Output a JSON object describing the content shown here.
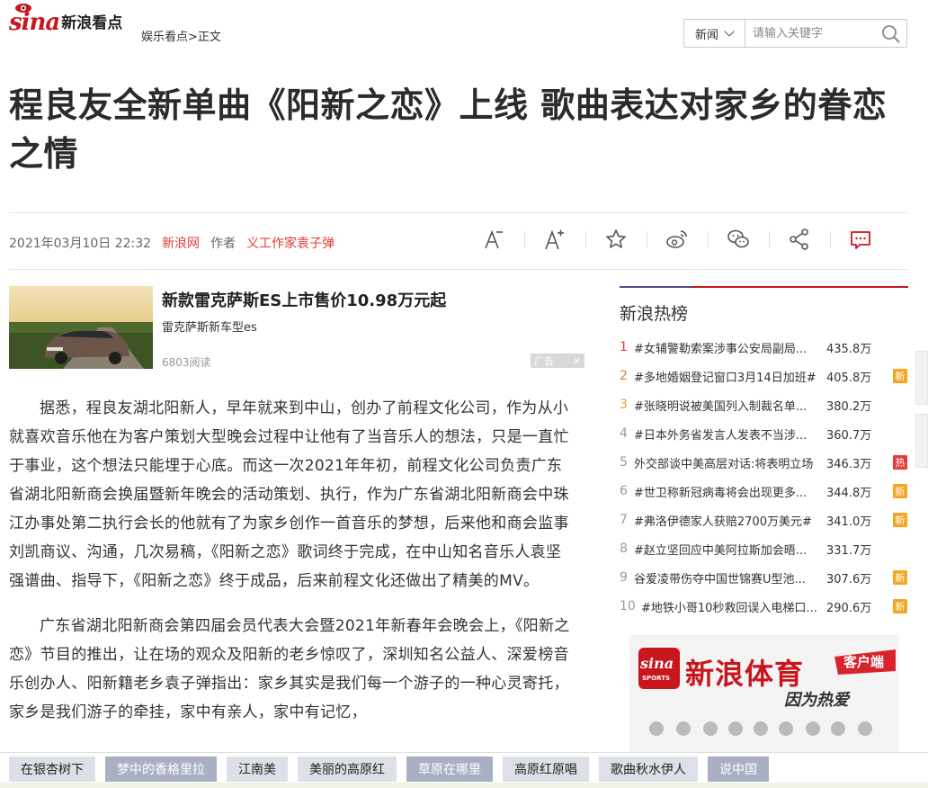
{
  "header": {
    "logo_text": "新浪看点",
    "logo_brand": "sina",
    "breadcrumb_section": "娱乐看点",
    "breadcrumb_sep": ">",
    "breadcrumb_current": "正文",
    "search_category": "新闻",
    "search_placeholder": "请输入关键字",
    "brand_color": "#c8161e"
  },
  "article": {
    "title": "程良友全新单曲《阳新之恋》上线 歌曲表达对家乡的眷恋之情",
    "datetime": "2021年03月10日 22:32",
    "source": "新浪网",
    "author_label": "作者",
    "author": "义工作家袁子弹",
    "tools": [
      "font-decrease-icon",
      "font-increase-icon",
      "star-icon",
      "weibo-icon",
      "wechat-icon",
      "share-icon",
      "comment-icon"
    ],
    "paragraphs": [
      "据悉，程良友湖北阳新人，早年就来到中山，创办了前程文化公司，作为从小就喜欢音乐他在为客户策划大型晚会过程中让他有了当音乐人的想法，只是一直忙于事业，这个想法只能埋于心底。而这一次2021年年初，前程文化公司负责广东省湖北阳新商会换届暨新年晚会的活动策划、执行，作为广东省湖北阳新商会中珠江办事处第二执行会长的他就有了为家乡创作一首音乐的梦想，后来他和商会监事刘凯商议、沟通，几次易稿，《阳新之恋》歌词终于完成，在中山知名音乐人袁坚强谱曲、指导下，《阳新之恋》终于成品，后来前程文化还做出了精美的MV。",
      "广东省湖北阳新商会第四届会员代表大会暨2021年新春年会晚会上，《阳新之恋》节目的推出，让在场的观众及阳新的老乡惊叹了，深圳知名公益人、深爱榜音乐创办人、阳新籍老乡袁子弹指出：家乡其实是我们每一个游子的一种心灵寄托，家乡是我们游子的牵挂，家中有亲人，家中有记忆，"
    ]
  },
  "ad": {
    "title": "新款雷克萨斯ES上市售价10.98万元起",
    "subtitle": "雷克萨斯新车型es",
    "reads": "6803阅读",
    "badge": "广告",
    "close": "✕"
  },
  "sidebar": {
    "title": "新浪热榜",
    "items": [
      {
        "rank": "1",
        "text": "#女辅警勒索案涉事公安局副局...",
        "count": "435.8万",
        "badge": ""
      },
      {
        "rank": "2",
        "text": "#多地婚姻登记窗口3月14日加班#",
        "count": "405.8万",
        "badge": "新"
      },
      {
        "rank": "3",
        "text": "#张晓明说被美国列入制裁名单...",
        "count": "380.2万",
        "badge": ""
      },
      {
        "rank": "4",
        "text": "#日本外务省发言人发表不当涉...",
        "count": "360.7万",
        "badge": ""
      },
      {
        "rank": "5",
        "text": "外交部谈中美高层对话:将表明立场",
        "count": "346.3万",
        "badge": "热"
      },
      {
        "rank": "6",
        "text": "#世卫称新冠病毒将会出现更多...",
        "count": "344.8万",
        "badge": "新"
      },
      {
        "rank": "7",
        "text": "#弗洛伊德家人获赔2700万美元#",
        "count": "341.0万",
        "badge": "新"
      },
      {
        "rank": "8",
        "text": "#赵立坚回应中美阿拉斯加会晤...",
        "count": "331.7万",
        "badge": ""
      },
      {
        "rank": "9",
        "text": "谷爱凌带伤夺中国世锦赛U型池...",
        "count": "307.6万",
        "badge": "新"
      },
      {
        "rank": "10",
        "text": "#地铁小哥10秒救回误入电梯口...",
        "count": "290.6万",
        "badge": "新"
      }
    ]
  },
  "sports_ad": {
    "brand": "新浪体育",
    "tag": "客户端",
    "slogan": "因为热爱",
    "logo_brand": "sina",
    "logo_sub": "SPORTS"
  },
  "bottom_tags": [
    "在银杏树下",
    "梦中的香格里拉",
    "江南美",
    "美丽的高原红",
    "草原在哪里",
    "高原红原唱",
    "歌曲秋水伊人",
    "说中国"
  ]
}
